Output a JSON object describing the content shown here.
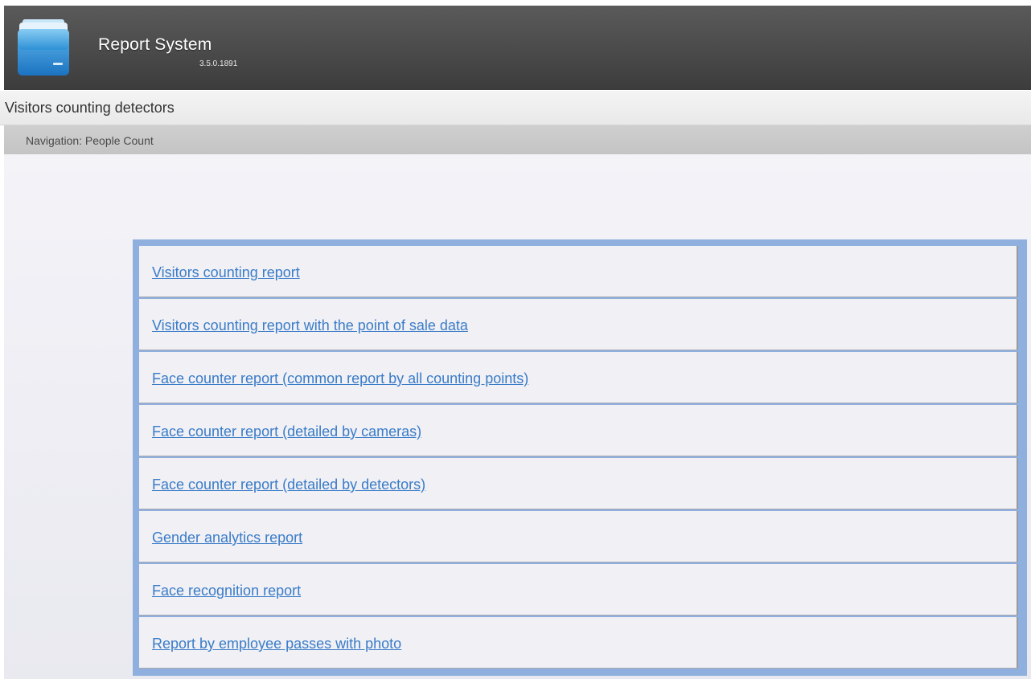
{
  "header": {
    "app_title": "Report System",
    "version": "3.5.0.1891",
    "logo_icon": "folder-icon"
  },
  "page": {
    "title": "Visitors counting detectors"
  },
  "navigation": {
    "text": "Navigation: People Count"
  },
  "reports": [
    {
      "label": "Visitors counting report"
    },
    {
      "label": "Visitors counting report with the point of sale data"
    },
    {
      "label": "Face counter report (common report by all counting points)"
    },
    {
      "label": "Face counter report (detailed by cameras)"
    },
    {
      "label": "Face counter report (detailed by detectors)"
    },
    {
      "label": "Gender analytics report"
    },
    {
      "label": "Face recognition report"
    },
    {
      "label": "Report by employee passes with photo"
    }
  ],
  "colors": {
    "header": "#4a4a4a",
    "link": "#3a7cc8",
    "panel_border": "#8fb0de"
  }
}
